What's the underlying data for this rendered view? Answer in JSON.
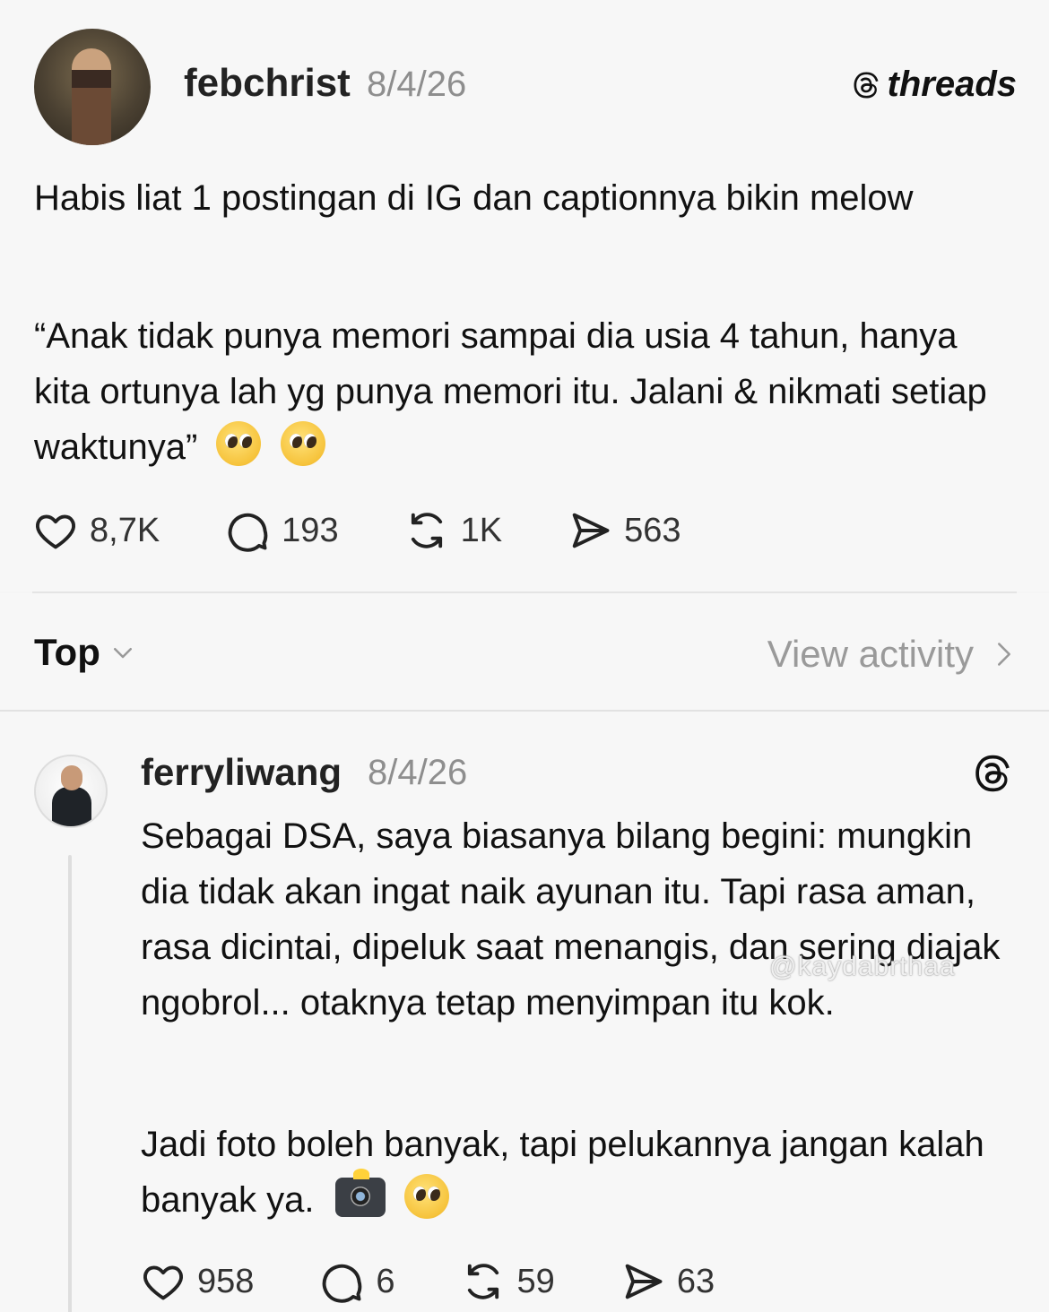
{
  "brand": {
    "logo_text": "threads"
  },
  "post": {
    "username": "febchrist",
    "date": "8/4/26",
    "paragraph1": "Habis liat 1 postingan di IG dan captionnya bikin melow",
    "paragraph2": "“Anak tidak punya memori sampai dia usia 4 tahun, hanya kita ortunya lah yg punya memori itu. Jalani & nikmati setiap waktunya”",
    "emojis": [
      "pleading-face",
      "pleading-face"
    ],
    "likes": "8,7K",
    "comments": "193",
    "reposts": "1K",
    "shares": "563"
  },
  "filter": {
    "sort_label": "Top",
    "view_activity_label": "View activity"
  },
  "reply": {
    "username": "ferryliwang",
    "date": "8/4/26",
    "paragraph1": "Sebagai DSA, saya biasanya bilang begini: mungkin dia tidak akan ingat naik ayunan itu. Tapi rasa aman, rasa dicintai, dipeluk saat menangis, dan sering diajak ngobrol... otaknya tetap menyimpan itu kok.",
    "paragraph2": "Jadi foto boleh banyak, tapi pelukannya jangan kalah banyak ya.",
    "emojis": [
      "camera-with-flash",
      "pleading-face"
    ],
    "likes": "958",
    "comments": "6",
    "reposts": "59",
    "shares": "63"
  },
  "watermark": "@kaydabrthaa"
}
